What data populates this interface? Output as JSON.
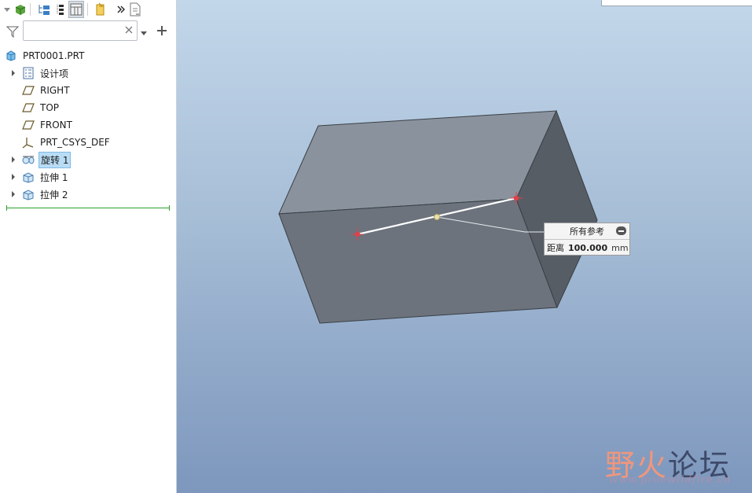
{
  "model_tree": {
    "search": {
      "value": "",
      "placeholder": ""
    },
    "root": {
      "label": "PRT0001.PRT",
      "icon": "part-icon"
    },
    "items": [
      {
        "label": "设计项",
        "icon": "design-items-icon",
        "expandable": true
      },
      {
        "label": "RIGHT",
        "icon": "datum-plane-icon",
        "expandable": false
      },
      {
        "label": "TOP",
        "icon": "datum-plane-icon",
        "expandable": false
      },
      {
        "label": "FRONT",
        "icon": "datum-plane-icon",
        "expandable": false
      },
      {
        "label": "PRT_CSYS_DEF",
        "icon": "coordinate-system-icon",
        "expandable": false
      },
      {
        "label": "旋转 1",
        "icon": "revolve-icon",
        "expandable": true,
        "selected": true
      },
      {
        "label": "拉伸 1",
        "icon": "extrude-icon",
        "expandable": true
      },
      {
        "label": "拉伸 2",
        "icon": "extrude-icon",
        "expandable": true
      }
    ]
  },
  "measure_box": {
    "title": "所有参考",
    "label": "距离",
    "value": "100.000",
    "unit": "mm"
  },
  "watermark": {
    "part1": "野火",
    "part2": "论坛",
    "url": "www.proewildfire.cn"
  },
  "colors": {
    "selection": "#b9dcf5",
    "insert_marker": "#2aa32a",
    "measure_point": "#e0404a",
    "box_top": "#8a939d",
    "box_front": "#6c737d",
    "box_side": "#575d65"
  }
}
